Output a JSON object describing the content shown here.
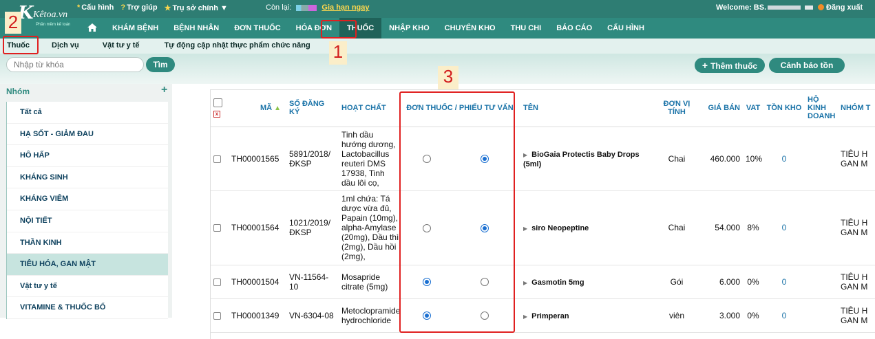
{
  "header": {
    "logo_text": "Kêtoa.vn",
    "logo_sub": "Phần mềm kế toán",
    "top_links": [
      {
        "icon": "*",
        "label": "Cấu hình"
      },
      {
        "icon": "?",
        "label": "Trợ giúp"
      },
      {
        "icon": "★",
        "label": "Trụ sở chính"
      }
    ],
    "remaining_label": "Còn lại:",
    "renew_label": "Gia hạn ngay",
    "welcome_label": "Welcome: BS.",
    "logout_label": "Đăng xuất"
  },
  "nav": {
    "home_icon": "home-icon",
    "items": [
      "KHÁM BỆNH",
      "BỆNH NHÂN",
      "ĐƠN THUỐC",
      "HÓA ĐƠN",
      "THUỐC",
      "NHẬP KHO",
      "CHUYỂN KHO",
      "THU CHI",
      "BÁO CÁO",
      "CẤU HÌNH"
    ],
    "active": "THUỐC"
  },
  "subnav": {
    "items": [
      "Thuốc",
      "Dịch vụ",
      "Vật tư y tế",
      "Tự động cập nhật thực phẩm chức năng"
    ]
  },
  "toolbar": {
    "search_placeholder": "Nhập từ khóa",
    "search_button": "Tìm",
    "add_button": "Thêm thuốc",
    "warn_button": "Cảnh báo tồn"
  },
  "sidebar": {
    "group_label": "Nhóm",
    "items": [
      "Tất cả",
      "HẠ SỐT - GIẢM ĐAU",
      "HÔ HẤP",
      "KHÁNG SINH",
      "KHÁNG VIÊM",
      "NỘI TIẾT",
      "THẦN KINH",
      "TIÊU HÓA, GAN MẬT",
      "Vật tư y tế",
      "VITAMINE & THUỐC BỔ"
    ],
    "selected": "TIÊU HÓA, GAN MẬT"
  },
  "table": {
    "headers": {
      "code": "MÃ",
      "reg": "SỐ ĐĂNG KÝ",
      "ingredient": "HOẠT CHẤT",
      "rx": "ĐƠN THUỐC / PHIẾU TƯ VẤN",
      "name": "TÊN",
      "unit": "ĐƠN VỊ TÍNH",
      "price": "GIÁ BÁN",
      "vat": "VAT",
      "stock": "TỒN KHO",
      "biz": "HỘ KINH DOANH",
      "group": "NHÓM T"
    },
    "rows": [
      {
        "code": "TH00001565",
        "reg": "5891/2018/ ĐKSP",
        "ingredient": "Tinh dầu hướng dương, Lactobacillus reuteri DMS 17938, Tinh dầu lôi cọ,",
        "rx": "phieu",
        "name": "BioGaia Protectis Baby Drops (5ml)",
        "unit": "Chai",
        "price": "460.000",
        "vat": "10%",
        "stock": "0",
        "group": "TIÊU H GAN M"
      },
      {
        "code": "TH00001564",
        "reg": "1021/2019/ ĐKSP",
        "ingredient": "1ml chứa: Tá dược vừa đủ, Papain (10mg), alpha-Amylase (20mg), Dầu thì (2mg), Dầu hồi (2mg),",
        "rx": "phieu",
        "name": "siro Neopeptine",
        "unit": "Chai",
        "price": "54.000",
        "vat": "8%",
        "stock": "0",
        "group": "TIÊU H GAN M"
      },
      {
        "code": "TH00001504",
        "reg": "VN-11564-10",
        "ingredient": "Mosapride citrate (5mg)",
        "rx": "don",
        "name": "Gasmotin 5mg",
        "unit": "Gói",
        "price": "6.000",
        "vat": "0%",
        "stock": "0",
        "group": "TIÊU H GAN M"
      },
      {
        "code": "TH00001349",
        "reg": "VN-6304-08",
        "ingredient": "Metoclopramide hydrochloride",
        "rx": "don",
        "name": "Primperan",
        "unit": "viên",
        "price": "3.000",
        "vat": "0%",
        "stock": "0",
        "group": "TIÊU H GAN M"
      }
    ]
  },
  "annotations": [
    "1",
    "2",
    "3"
  ],
  "colors": {
    "primary": "#2f8a7f",
    "active_nav": "#1f6259",
    "annotation": "#e02020",
    "link": "#1a73a8"
  }
}
